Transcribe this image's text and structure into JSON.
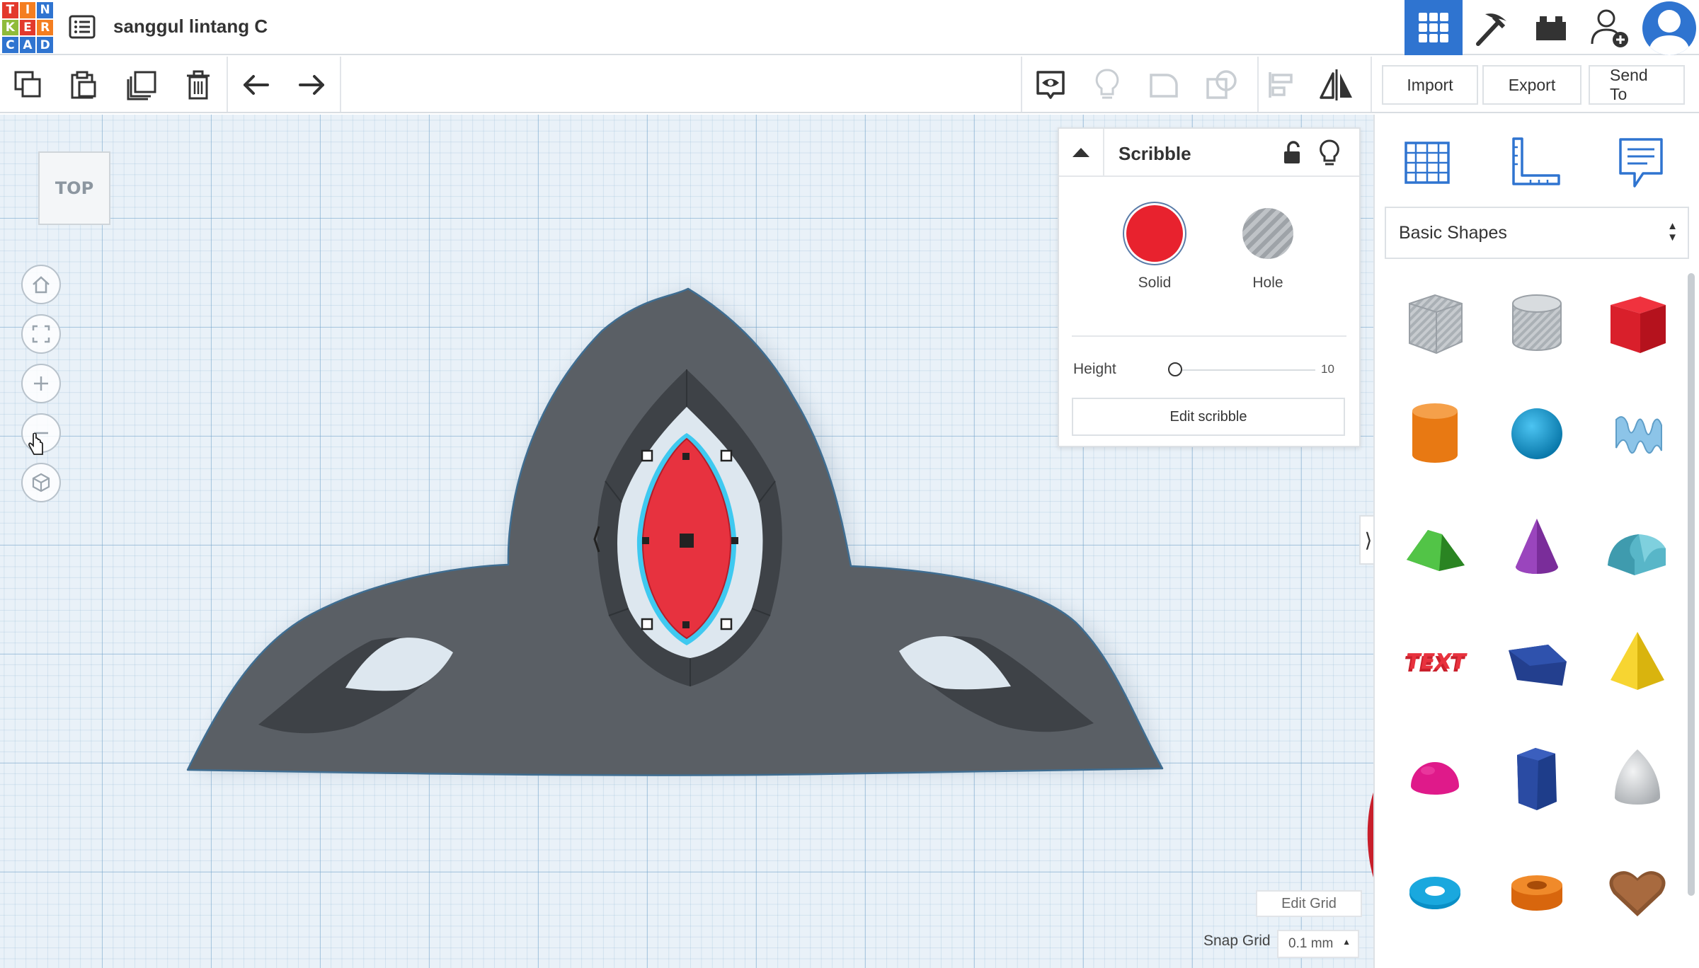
{
  "header": {
    "logo_letters": [
      "T",
      "I",
      "N",
      "K",
      "E",
      "R",
      "C",
      "A",
      "D"
    ],
    "logo_colors": [
      "#e3392c",
      "#f47e20",
      "#2f74d0",
      "#8fbb3a",
      "#e3392c",
      "#f47e20",
      "#2f74d0",
      "#2f74d0",
      "#2f74d0"
    ],
    "project_title": "sanggul lintang C",
    "accent_color": "#2f74d0"
  },
  "toolbar": {
    "left_tools": [
      "copy-icon",
      "paste-icon",
      "duplicate-icon",
      "delete-icon",
      "undo-icon",
      "redo-icon"
    ],
    "right_tools": [
      "show-all-icon",
      "light-bulb-icon",
      "group-icon",
      "ungroup-icon",
      "align-icon",
      "mirror-icon"
    ],
    "import_label": "Import",
    "export_label": "Export",
    "send_to_label": "Send To"
  },
  "view": {
    "cube_label": "TOP",
    "controls": [
      "home-view-icon",
      "fit-view-icon",
      "zoom-in-icon",
      "zoom-out-icon",
      "perspective-icon"
    ]
  },
  "inspector": {
    "title": "Scribble",
    "solid_label": "Solid",
    "hole_label": "Hole",
    "solid_color": "#e8222e",
    "height_label": "Height",
    "height_value": "10",
    "edit_button": "Edit scribble"
  },
  "workplane": {
    "edit_grid_label": "Edit Grid",
    "snap_grid_label": "Snap Grid",
    "snap_grid_value": "0.1 mm"
  },
  "shapes_panel": {
    "tabs": [
      "workplane-icon",
      "ruler-icon",
      "notes-icon"
    ],
    "category": "Basic Shapes",
    "shapes": [
      "box-hole",
      "cylinder-hole",
      "box",
      "cylinder",
      "sphere",
      "scribble",
      "roof",
      "cone",
      "round-roof",
      "text",
      "polygon",
      "pyramid",
      "half-sphere",
      "hexagonal-prism",
      "paraboloid",
      "torus",
      "tube",
      "heart"
    ]
  }
}
